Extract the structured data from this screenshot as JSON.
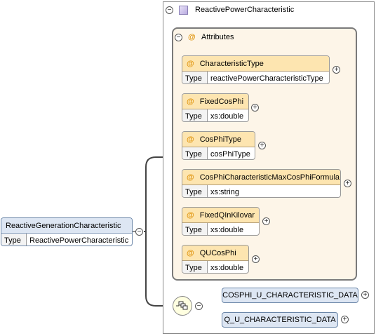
{
  "root": {
    "name": "ReactiveGenerationCharacteristic",
    "type_label": "Type",
    "type_value": "ReactivePowerCharacteristic"
  },
  "complex_type": {
    "name": "ReactivePowerCharacteristic"
  },
  "attributes_group": {
    "label": "Attributes"
  },
  "attributes": [
    {
      "name": "CharacteristicType",
      "type_label": "Type",
      "type_value": "reactivePowerCharacteristicType"
    },
    {
      "name": "FixedCosPhi",
      "type_label": "Type",
      "type_value": "xs:double"
    },
    {
      "name": "CosPhiType",
      "type_label": "Type",
      "type_value": "cosPhiType"
    },
    {
      "name": "CosPhiCharacteristicMaxCosPhiFormula",
      "type_label": "Type",
      "type_value": "xs:string"
    },
    {
      "name": "FixedQInKilovar",
      "type_label": "Type",
      "type_value": "xs:double"
    },
    {
      "name": "QUCosPhi",
      "type_label": "Type",
      "type_value": "xs:double"
    }
  ],
  "sequence_children": [
    {
      "name": "COSPHI_U_CHARACTERISTIC_DATA"
    },
    {
      "name": "Q_U_CHARACTERISTIC_DATA"
    }
  ],
  "symbols": {
    "attr_marker": "@",
    "collapse": "−",
    "expand": "+"
  },
  "colors": {
    "element_fill": "#dde6f3",
    "attribute_header": "#fde5b0",
    "attribute_group_fill": "#fdf5e8",
    "attr_marker": "#e0950e"
  }
}
